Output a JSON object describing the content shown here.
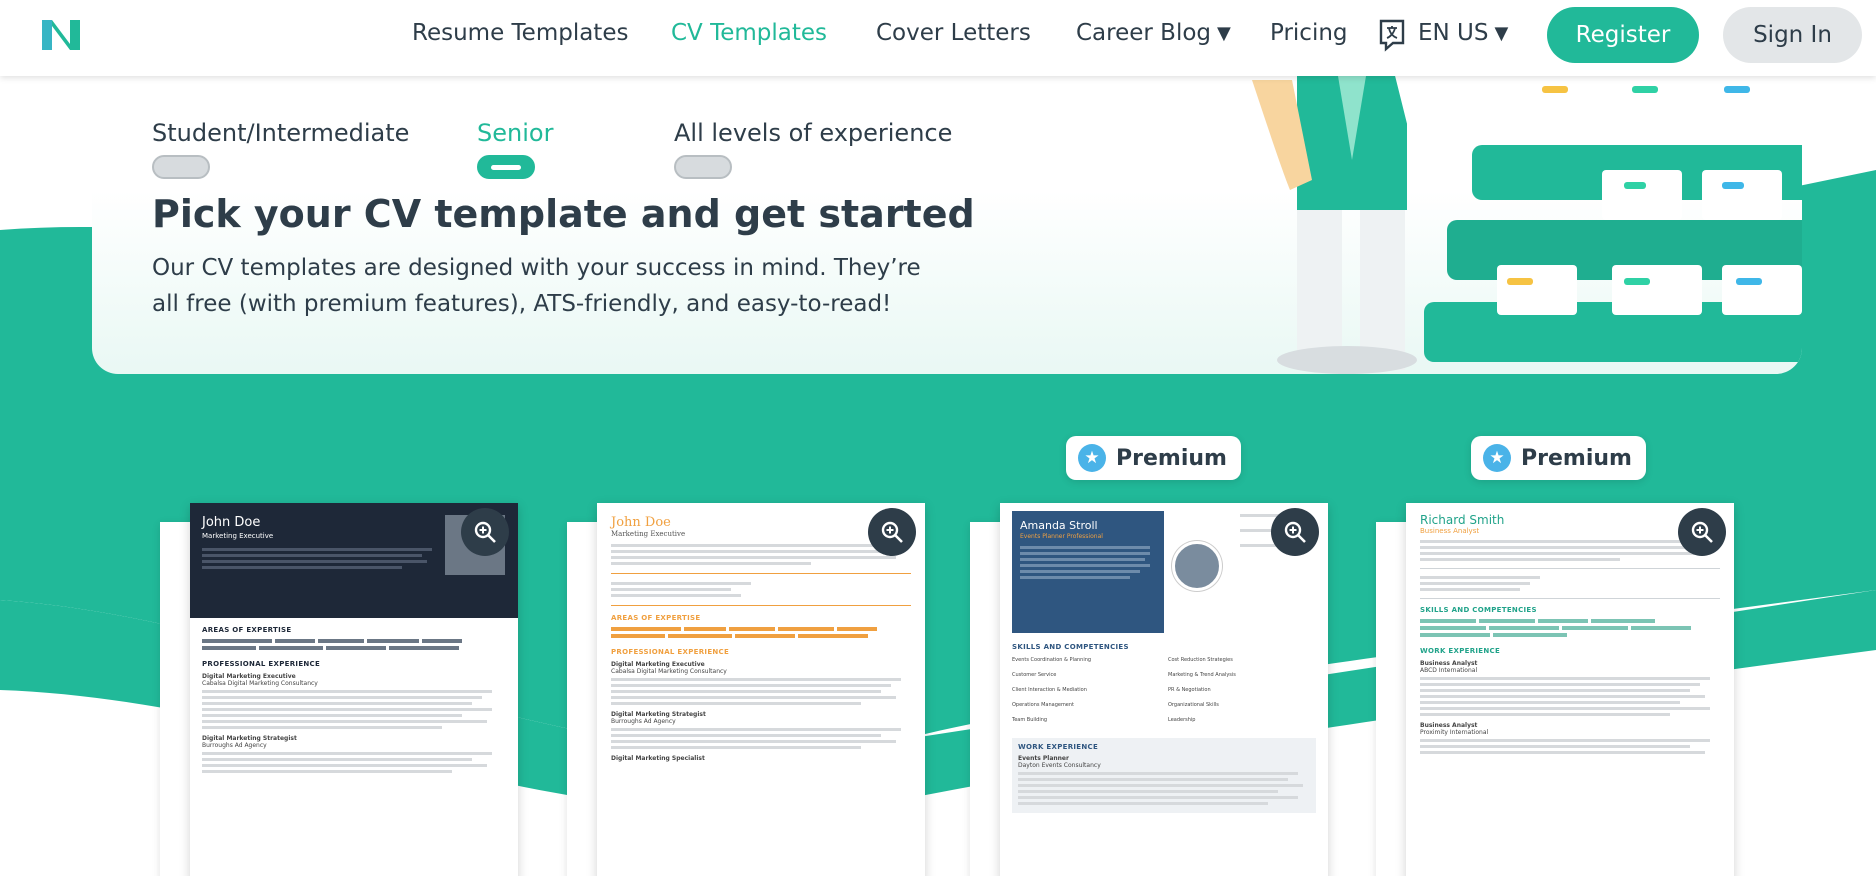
{
  "nav": {
    "links": [
      {
        "label": "Resume Templates"
      },
      {
        "label": "CV Templates"
      },
      {
        "label": "Cover Letters"
      },
      {
        "label": "Career Blog"
      },
      {
        "label": "Pricing"
      }
    ],
    "language": "EN US",
    "register": "Register",
    "sign_in": "Sign In"
  },
  "filters": [
    {
      "label": "Student/Intermediate",
      "active": false
    },
    {
      "label": "Senior",
      "active": true
    },
    {
      "label": "All levels of experience",
      "active": false
    }
  ],
  "hero": {
    "title": "Pick your CV template and get started",
    "subtitle": "Our CV templates are designed with your success in mind. They’re all free (with premium features), ATS-friendly, and easy-to-read!"
  },
  "premium_label": "Premium",
  "colors": {
    "accent": "#21b999",
    "dark": "#2e3d49",
    "premium_star": "#4ab3e8"
  },
  "templates": [
    {
      "name": "John Doe",
      "role": "Marketing Executive",
      "sections": [
        "AREAS OF EXPERTISE",
        "PROFESSIONAL EXPERIENCE"
      ],
      "jobs": [
        {
          "title": "Digital Marketing Executive",
          "company": "Cabalsa Digital Marketing Consultancy"
        },
        {
          "title": "Digital Marketing Strategist",
          "company": "Burroughs Ad Agency"
        }
      ],
      "premium": false
    },
    {
      "name": "John Doe",
      "role": "Marketing Executive",
      "sections": [
        "AREAS OF EXPERTISE",
        "PROFESSIONAL EXPERIENCE"
      ],
      "jobs": [
        {
          "title": "Digital Marketing Executive",
          "company": "Cabalsa Digital Marketing Consultancy"
        },
        {
          "title": "Digital Marketing Strategist",
          "company": "Burroughs Ad Agency"
        },
        {
          "title": "Digital Marketing Specialist",
          "company": ""
        }
      ],
      "premium": false
    },
    {
      "name": "Amanda Stroll",
      "role": "Events Planner Professional",
      "sections": [
        "SKILLS AND COMPETENCIES",
        "WORK EXPERIENCE"
      ],
      "skills_left": [
        "Events Coordination & Planning",
        "Customer Service",
        "Client Interaction & Mediation",
        "Operations Management",
        "Team Building"
      ],
      "skills_right": [
        "Cost Reduction Strategies",
        "Marketing & Trend Analysis",
        "PR & Negotiation",
        "Organizational Skills",
        "Leadership"
      ],
      "jobs": [
        {
          "title": "Events Planner",
          "company": "Dayton Events Consultancy"
        }
      ],
      "premium": true
    },
    {
      "name": "Richard Smith",
      "role": "Business Analyst",
      "sections": [
        "SKILLS AND COMPETENCIES",
        "WORK EXPERIENCE"
      ],
      "jobs": [
        {
          "title": "Business Analyst",
          "company": "ABCD International"
        },
        {
          "title": "Business Analyst",
          "company": "Proximity International"
        }
      ],
      "premium": true
    }
  ]
}
